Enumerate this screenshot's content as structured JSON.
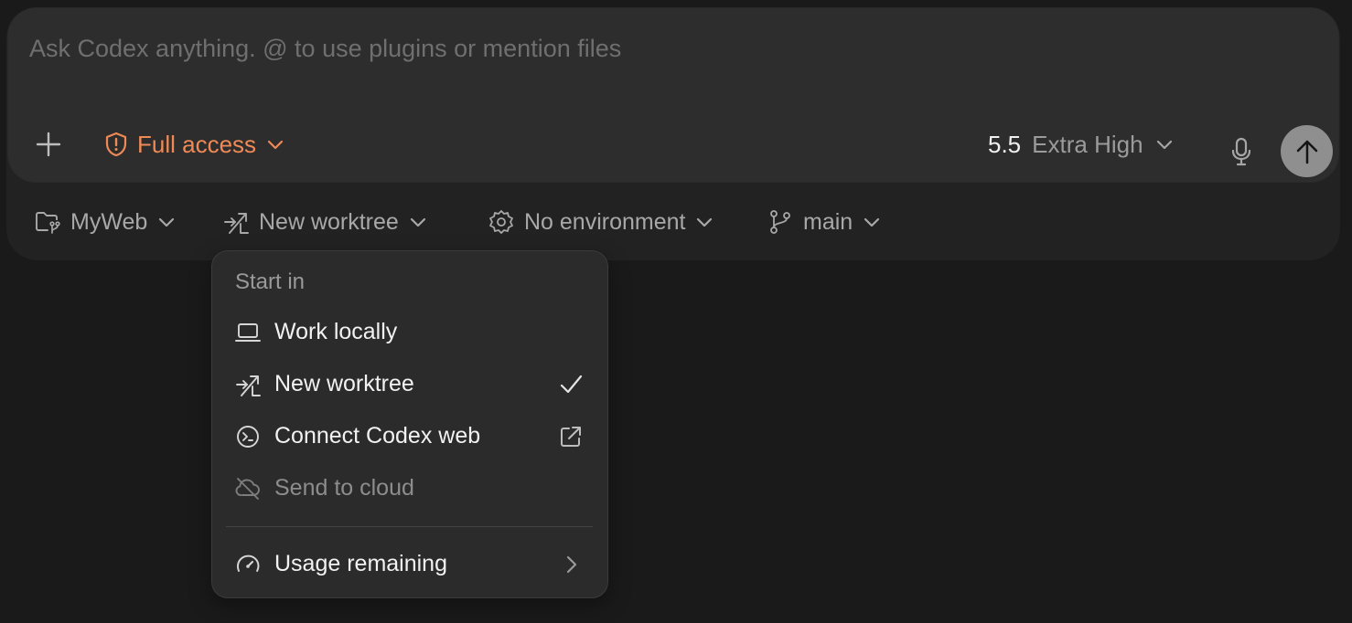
{
  "composer": {
    "placeholder": "Ask Codex anything. @ to use plugins or mention files",
    "access_label": "Full access",
    "model_version": "5.5",
    "model_effort": "Extra High"
  },
  "context_bar": {
    "project": "MyWeb",
    "start_mode": "New worktree",
    "environment": "No environment",
    "branch": "main"
  },
  "menu": {
    "heading": "Start in",
    "items": [
      {
        "label": "Work locally",
        "icon": "laptop-icon",
        "selected": false,
        "disabled": false
      },
      {
        "label": "New worktree",
        "icon": "worktree-icon",
        "selected": true,
        "disabled": false
      },
      {
        "label": "Connect Codex web",
        "icon": "terminal-circle-icon",
        "selected": false,
        "disabled": false
      },
      {
        "label": "Send to cloud",
        "icon": "cloud-off-icon",
        "selected": false,
        "disabled": true
      }
    ],
    "footer_item": {
      "label": "Usage remaining",
      "icon": "gauge-icon"
    }
  },
  "colors": {
    "background": "#1a1a1a",
    "composer": "#2d2d2d",
    "access_accent": "#ef8a57",
    "send_button": "#8f8f8f",
    "menu_background": "#2b2b2b"
  }
}
